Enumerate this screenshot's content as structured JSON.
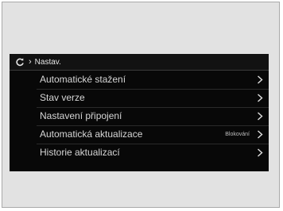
{
  "header": {
    "home_icon": "refresh-icon",
    "separator_icon": "chevron-right-icon",
    "title": "Nastav."
  },
  "menu": {
    "items": [
      {
        "label": "Automatické stažení",
        "status": "",
        "icon": "chevron-right-icon"
      },
      {
        "label": "Stav verze",
        "status": "",
        "icon": "chevron-right-icon"
      },
      {
        "label": "Nastavení připojení",
        "status": "",
        "icon": "chevron-right-icon"
      },
      {
        "label": "Automatická aktualizace",
        "status": "Blokování",
        "icon": "chevron-right-icon"
      },
      {
        "label": "Historie aktualizací",
        "status": "",
        "icon": "chevron-right-icon"
      }
    ]
  },
  "colors": {
    "screen_background": "#080808",
    "text": "#d6d6d6",
    "frame": "#e2e2e2"
  }
}
